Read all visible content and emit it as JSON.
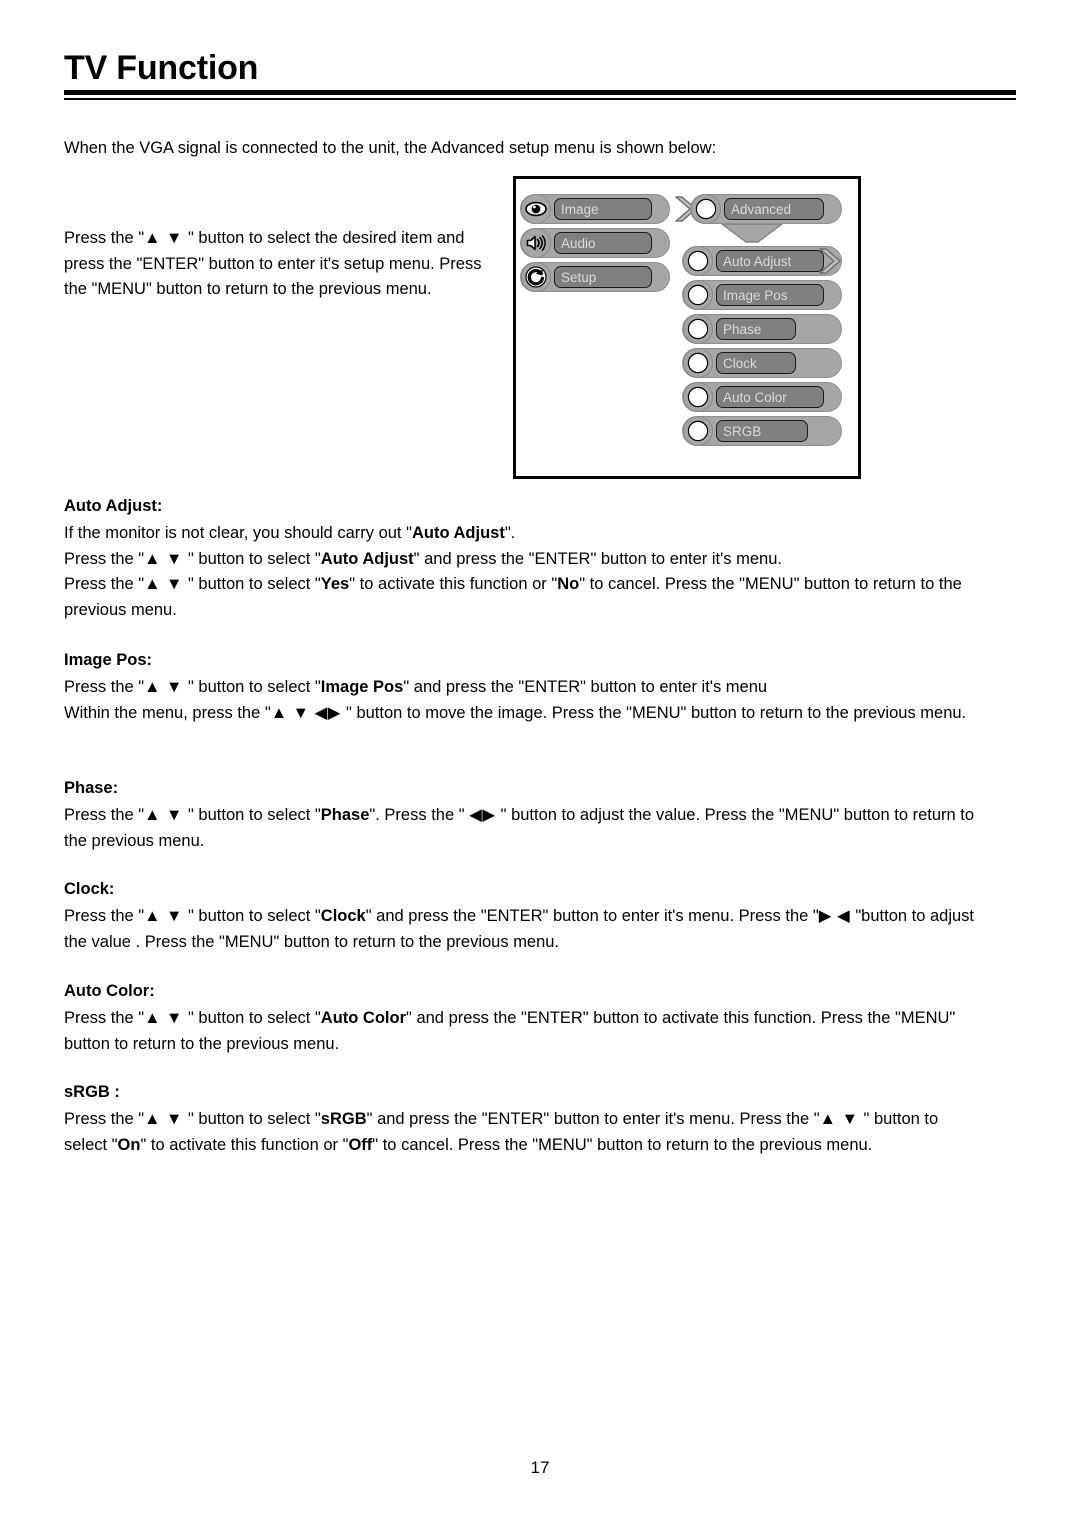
{
  "document": {
    "heading": "TV Function",
    "page_number": "17",
    "intro": "When the VGA signal is connected to the unit, the Advanced setup menu is shown below:",
    "left_instructions": "Press the \"▲ ▼ \" button to select the desired item and press the \"ENTER\" button to enter it's setup menu. Press the \"MENU\" button to return to the previous menu."
  },
  "osd_menu": {
    "main_items": [
      {
        "label": "Image",
        "icon": "eye-icon"
      },
      {
        "label": "Audio",
        "icon": "speaker-icon"
      },
      {
        "label": "Setup",
        "icon": "refresh-icon"
      }
    ],
    "advanced": {
      "label": "Advanced",
      "icon": "crescent-moon-icon"
    },
    "submenu_items": [
      {
        "label": "Auto Adjust",
        "icon": "crescent-moon-icon"
      },
      {
        "label": "Image Pos",
        "icon": "crescent-moon-icon"
      },
      {
        "label": "Phase",
        "icon": "crescent-moon-icon"
      },
      {
        "label": "Clock",
        "icon": "crescent-moon-icon"
      },
      {
        "label": "Auto Color",
        "icon": "crescent-moon-icon"
      },
      {
        "label": "SRGB",
        "icon": "crescent-moon-icon"
      }
    ],
    "colors": {
      "capsule": "#a6a6a6",
      "pill": "#808080",
      "pill_text": "#d8d8d8",
      "border": "#000000"
    }
  },
  "sections": [
    {
      "title": "Auto Adjust:",
      "lines": [
        "If the monitor is not clear, you should carry out \"Auto Adjust\".",
        "Press the \"▲ ▼ \" button to select \"Auto Adjust\" and press the \"ENTER\" button to enter it's menu.",
        "Press the \"▲ ▼ \" button to select \"Yes\" to activate this function or \"No\" to cancel. Press the \"MENU\" button to return to the previous menu."
      ]
    },
    {
      "title": "Image Pos:",
      "lines": [
        "Press the \"▲ ▼ \" button to select \"Image Pos\" and press the \"ENTER\" button to enter it's menu",
        "Within the menu, press the \"▲ ▼ ◀▶ \" button to move the image. Press the \"MENU\" button to return to the previous menu."
      ]
    },
    {
      "title": "Phase:",
      "lines": [
        "Press the \"▲ ▼ \" button to select \"Phase\". Press the \" ◀▶ \" button to adjust the value. Press the \"MENU\" button to return to the previous menu."
      ]
    },
    {
      "title": "Clock:",
      "lines": [
        "Press the \"▲ ▼ \" button to select \"Clock\" and press the \"ENTER\" button to enter it's menu. Press the \"▶ ◀ \"button to adjust the value . Press the \"MENU\" button to return to the previous menu."
      ]
    },
    {
      "title": "Auto Color:",
      "lines": [
        "Press the \"▲ ▼ \" button to select \"Auto Color\" and press the \"ENTER\" button to activate this function. Press the \"MENU\" button to return to the previous menu."
      ]
    },
    {
      "title": "sRGB :",
      "lines": [
        "Press the \"▲ ▼ \" button to select \"sRGB\" and press the \"ENTER\" button to enter it's menu. Press the \"▲ ▼ \" button to select \"On\" to activate this function or \"Off\" to cancel. Press the \"MENU\" button to return to the previous menu."
      ]
    }
  ]
}
